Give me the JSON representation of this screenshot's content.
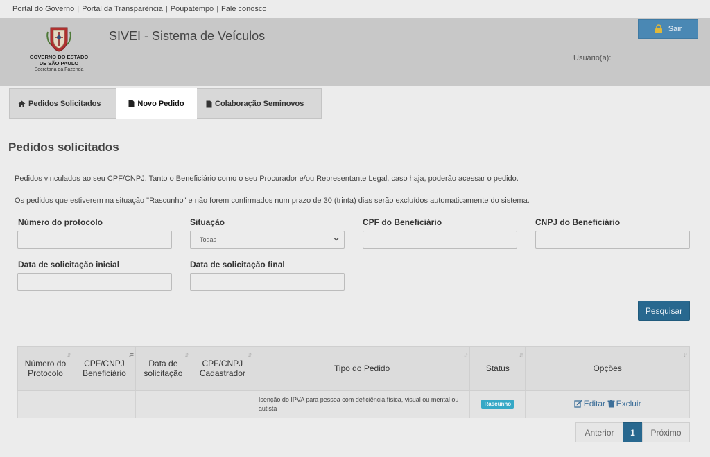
{
  "top_links": [
    "Portal do Governo",
    "Portal da Transparência",
    "Poupatempo",
    "Fale conosco"
  ],
  "header": {
    "logo_line1": "GOVERNO DO ESTADO",
    "logo_line2": "DE SÃO PAULO",
    "logo_line3": "Secretaria da Fazenda",
    "app_title": "SIVEI - Sistema de Veículos",
    "user_label": "Usuário(a):",
    "logout_label": "Sair"
  },
  "tabs": [
    {
      "label": "Pedidos Solicitados",
      "icon": "home-icon"
    },
    {
      "label": "Novo Pedido",
      "icon": "document-icon"
    },
    {
      "label": "Colaboração Seminovos",
      "icon": "document-icon"
    }
  ],
  "page": {
    "title": "Pedidos solicitados",
    "info1": "Pedidos vinculados ao seu CPF/CNPJ. Tanto o Beneficiário como o seu Procurador e/ou Representante Legal, caso haja, poderão acessar o pedido.",
    "info2": "Os pedidos que estiverem na situação \"Rascunho\" e não forem confirmados num prazo de 30 (trinta) dias serão excluídos automaticamente do sistema."
  },
  "filters": {
    "protocolo_label": "Número do protocolo",
    "situacao_label": "Situação",
    "situacao_value": "Todas",
    "cpf_label": "CPF do Beneficiário",
    "cnpj_label": "CNPJ do Beneficiário",
    "data_inicial_label": "Data de solicitação inicial",
    "data_final_label": "Data de solicitação final",
    "search_label": "Pesquisar"
  },
  "table": {
    "columns": [
      "Número do Protocolo",
      "CPF/CNPJ Beneficiário",
      "Data de solicitação",
      "CPF/CNPJ Cadastrador",
      "Tipo do Pedido",
      "Status",
      "Opções"
    ],
    "rows": [
      {
        "protocolo": "",
        "cpf_beneficiario": "",
        "data": "",
        "cpf_cadastrador": "",
        "tipo": "Isenção do IPVA para pessoa com deficiência física, visual ou mental ou autista",
        "status": "Rascunho",
        "edit_label": "Editar",
        "delete_label": "Excluir"
      }
    ]
  },
  "pagination": {
    "prev": "Anterior",
    "current": "1",
    "next": "Próximo"
  },
  "colors": {
    "header_bg": "#c8c8c8",
    "primary_button": "#28688f",
    "status_badge": "#36a8c6",
    "link": "#3d6f99"
  }
}
